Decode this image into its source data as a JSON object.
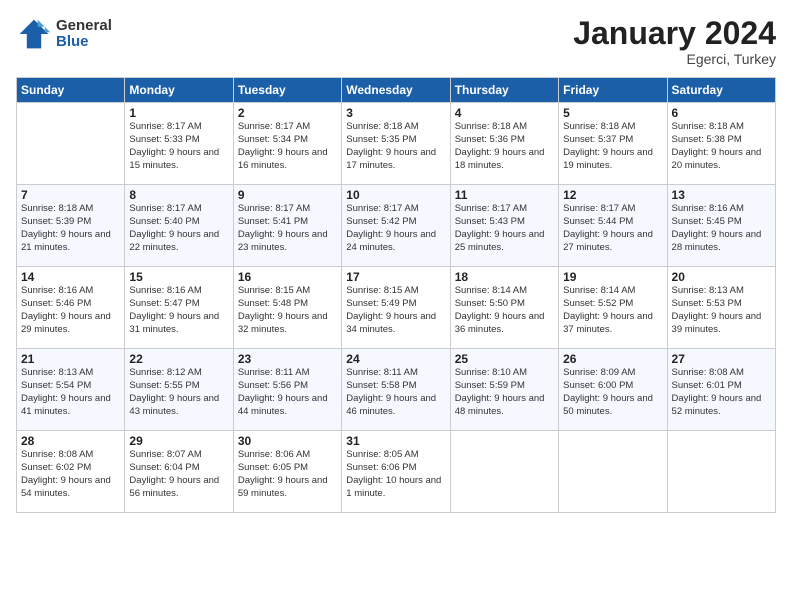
{
  "logo": {
    "general": "General",
    "blue": "Blue"
  },
  "header": {
    "month": "January 2024",
    "location": "Egerci, Turkey"
  },
  "weekdays": [
    "Sunday",
    "Monday",
    "Tuesday",
    "Wednesday",
    "Thursday",
    "Friday",
    "Saturday"
  ],
  "weeks": [
    [
      {
        "day": "",
        "sunrise": "",
        "sunset": "",
        "daylight": ""
      },
      {
        "day": "1",
        "sunrise": "Sunrise: 8:17 AM",
        "sunset": "Sunset: 5:33 PM",
        "daylight": "Daylight: 9 hours and 15 minutes."
      },
      {
        "day": "2",
        "sunrise": "Sunrise: 8:17 AM",
        "sunset": "Sunset: 5:34 PM",
        "daylight": "Daylight: 9 hours and 16 minutes."
      },
      {
        "day": "3",
        "sunrise": "Sunrise: 8:18 AM",
        "sunset": "Sunset: 5:35 PM",
        "daylight": "Daylight: 9 hours and 17 minutes."
      },
      {
        "day": "4",
        "sunrise": "Sunrise: 8:18 AM",
        "sunset": "Sunset: 5:36 PM",
        "daylight": "Daylight: 9 hours and 18 minutes."
      },
      {
        "day": "5",
        "sunrise": "Sunrise: 8:18 AM",
        "sunset": "Sunset: 5:37 PM",
        "daylight": "Daylight: 9 hours and 19 minutes."
      },
      {
        "day": "6",
        "sunrise": "Sunrise: 8:18 AM",
        "sunset": "Sunset: 5:38 PM",
        "daylight": "Daylight: 9 hours and 20 minutes."
      }
    ],
    [
      {
        "day": "7",
        "sunrise": "Sunrise: 8:18 AM",
        "sunset": "Sunset: 5:39 PM",
        "daylight": "Daylight: 9 hours and 21 minutes."
      },
      {
        "day": "8",
        "sunrise": "Sunrise: 8:17 AM",
        "sunset": "Sunset: 5:40 PM",
        "daylight": "Daylight: 9 hours and 22 minutes."
      },
      {
        "day": "9",
        "sunrise": "Sunrise: 8:17 AM",
        "sunset": "Sunset: 5:41 PM",
        "daylight": "Daylight: 9 hours and 23 minutes."
      },
      {
        "day": "10",
        "sunrise": "Sunrise: 8:17 AM",
        "sunset": "Sunset: 5:42 PM",
        "daylight": "Daylight: 9 hours and 24 minutes."
      },
      {
        "day": "11",
        "sunrise": "Sunrise: 8:17 AM",
        "sunset": "Sunset: 5:43 PM",
        "daylight": "Daylight: 9 hours and 25 minutes."
      },
      {
        "day": "12",
        "sunrise": "Sunrise: 8:17 AM",
        "sunset": "Sunset: 5:44 PM",
        "daylight": "Daylight: 9 hours and 27 minutes."
      },
      {
        "day": "13",
        "sunrise": "Sunrise: 8:16 AM",
        "sunset": "Sunset: 5:45 PM",
        "daylight": "Daylight: 9 hours and 28 minutes."
      }
    ],
    [
      {
        "day": "14",
        "sunrise": "Sunrise: 8:16 AM",
        "sunset": "Sunset: 5:46 PM",
        "daylight": "Daylight: 9 hours and 29 minutes."
      },
      {
        "day": "15",
        "sunrise": "Sunrise: 8:16 AM",
        "sunset": "Sunset: 5:47 PM",
        "daylight": "Daylight: 9 hours and 31 minutes."
      },
      {
        "day": "16",
        "sunrise": "Sunrise: 8:15 AM",
        "sunset": "Sunset: 5:48 PM",
        "daylight": "Daylight: 9 hours and 32 minutes."
      },
      {
        "day": "17",
        "sunrise": "Sunrise: 8:15 AM",
        "sunset": "Sunset: 5:49 PM",
        "daylight": "Daylight: 9 hours and 34 minutes."
      },
      {
        "day": "18",
        "sunrise": "Sunrise: 8:14 AM",
        "sunset": "Sunset: 5:50 PM",
        "daylight": "Daylight: 9 hours and 36 minutes."
      },
      {
        "day": "19",
        "sunrise": "Sunrise: 8:14 AM",
        "sunset": "Sunset: 5:52 PM",
        "daylight": "Daylight: 9 hours and 37 minutes."
      },
      {
        "day": "20",
        "sunrise": "Sunrise: 8:13 AM",
        "sunset": "Sunset: 5:53 PM",
        "daylight": "Daylight: 9 hours and 39 minutes."
      }
    ],
    [
      {
        "day": "21",
        "sunrise": "Sunrise: 8:13 AM",
        "sunset": "Sunset: 5:54 PM",
        "daylight": "Daylight: 9 hours and 41 minutes."
      },
      {
        "day": "22",
        "sunrise": "Sunrise: 8:12 AM",
        "sunset": "Sunset: 5:55 PM",
        "daylight": "Daylight: 9 hours and 43 minutes."
      },
      {
        "day": "23",
        "sunrise": "Sunrise: 8:11 AM",
        "sunset": "Sunset: 5:56 PM",
        "daylight": "Daylight: 9 hours and 44 minutes."
      },
      {
        "day": "24",
        "sunrise": "Sunrise: 8:11 AM",
        "sunset": "Sunset: 5:58 PM",
        "daylight": "Daylight: 9 hours and 46 minutes."
      },
      {
        "day": "25",
        "sunrise": "Sunrise: 8:10 AM",
        "sunset": "Sunset: 5:59 PM",
        "daylight": "Daylight: 9 hours and 48 minutes."
      },
      {
        "day": "26",
        "sunrise": "Sunrise: 8:09 AM",
        "sunset": "Sunset: 6:00 PM",
        "daylight": "Daylight: 9 hours and 50 minutes."
      },
      {
        "day": "27",
        "sunrise": "Sunrise: 8:08 AM",
        "sunset": "Sunset: 6:01 PM",
        "daylight": "Daylight: 9 hours and 52 minutes."
      }
    ],
    [
      {
        "day": "28",
        "sunrise": "Sunrise: 8:08 AM",
        "sunset": "Sunset: 6:02 PM",
        "daylight": "Daylight: 9 hours and 54 minutes."
      },
      {
        "day": "29",
        "sunrise": "Sunrise: 8:07 AM",
        "sunset": "Sunset: 6:04 PM",
        "daylight": "Daylight: 9 hours and 56 minutes."
      },
      {
        "day": "30",
        "sunrise": "Sunrise: 8:06 AM",
        "sunset": "Sunset: 6:05 PM",
        "daylight": "Daylight: 9 hours and 59 minutes."
      },
      {
        "day": "31",
        "sunrise": "Sunrise: 8:05 AM",
        "sunset": "Sunset: 6:06 PM",
        "daylight": "Daylight: 10 hours and 1 minute."
      },
      {
        "day": "",
        "sunrise": "",
        "sunset": "",
        "daylight": ""
      },
      {
        "day": "",
        "sunrise": "",
        "sunset": "",
        "daylight": ""
      },
      {
        "day": "",
        "sunrise": "",
        "sunset": "",
        "daylight": ""
      }
    ]
  ]
}
